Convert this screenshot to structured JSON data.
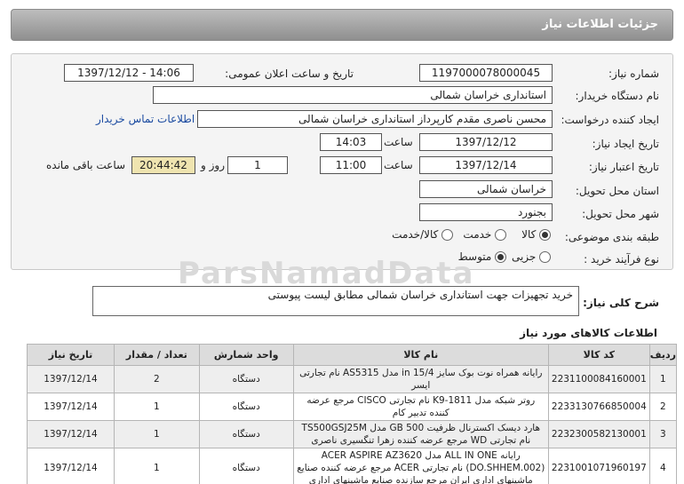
{
  "header": {
    "title": "جزئیات اطلاعات نیاز"
  },
  "fields": {
    "need_number_label": "شماره نیاز:",
    "need_number": "1197000078000045",
    "announce_label": "تاریخ و ساعت اعلان عمومی:",
    "announce_value": "1397/12/12 - 14:06",
    "buyer_org_label": "نام دستگاه خریدار:",
    "buyer_org": "استانداری خراسان شمالی",
    "requester_label": "ایجاد کننده درخواست:",
    "requester": "محسن ناصری مقدم کارپرداز استانداری خراسان شمالی",
    "contact_link": "اطلاعات تماس خریدار",
    "created_label": "تاریخ ایجاد نیاز:",
    "created_date": "1397/12/12",
    "time_label": "ساعت",
    "created_time": "14:03",
    "validity_label": "تاریخ اعتبار نیاز:",
    "validity_date": "1397/12/14",
    "validity_time": "11:00",
    "days_value": "1",
    "days_label": "روز و",
    "remaining_time": "20:44:42",
    "remaining_label": "ساعت باقی مانده",
    "province_label": "استان محل تحویل:",
    "province": "خراسان شمالی",
    "city_label": "شهر محل تحویل:",
    "city": "بجنورد",
    "category_label": "طبقه بندی موضوعی:",
    "category_options": [
      "کالا",
      "خدمت",
      "کالا/خدمت"
    ],
    "category_selected": "کالا",
    "process_label": "نوع فرآیند خرید :",
    "process_options": [
      "جزیی",
      "متوسط"
    ],
    "process_selected": "متوسط"
  },
  "watermark": "ParsNamadData",
  "description": {
    "label": "شرح کلی نیاز:",
    "text": "خرید تجهیزات جهت استانداری خراسان شمالی مطابق لیست پیوستی"
  },
  "goods": {
    "title": "اطلاعات کالاهای مورد نیاز",
    "columns": [
      "ردیف",
      "کد کالا",
      "نام کالا",
      "واحد شمارش",
      "تعداد / مقدار",
      "تاریخ نیاز"
    ],
    "rows": [
      {
        "row": "1",
        "code": "2231100084160001",
        "name": "رایانه همراه نوت بوک سایز 15/4 in مدل AS5315 نام تجارتی ایسر",
        "unit": "دستگاه",
        "qty": "2",
        "date": "1397/12/14"
      },
      {
        "row": "2",
        "code": "2233130766850004",
        "name": "روتر شبکه مدل K9-1811 نام تجارتی CISCO مرجع عرضه کننده تدبیر کام",
        "unit": "دستگاه",
        "qty": "1",
        "date": "1397/12/14"
      },
      {
        "row": "3",
        "code": "2232300582130001",
        "name": "هارد دیسک اکسترنال ظرفیت 500 GB مدل TS500GSJ25M نام تجارتی WD مرجع عرضه کننده زهرا تنگسیری ناصری",
        "unit": "دستگاه",
        "qty": "1",
        "date": "1397/12/14"
      },
      {
        "row": "4",
        "code": "2231001071960197",
        "name": "رایانه ALL IN ONE مدل ACER ASPIRE AZ3620 (DO.SHHEM.002) نام تجارتی ACER مرجع عرضه کننده صنایع ماشینهای اداری ایران مرجع سازنده صنایع ماشینهای اداری",
        "unit": "دستگاه",
        "qty": "1",
        "date": "1397/12/14"
      }
    ]
  }
}
